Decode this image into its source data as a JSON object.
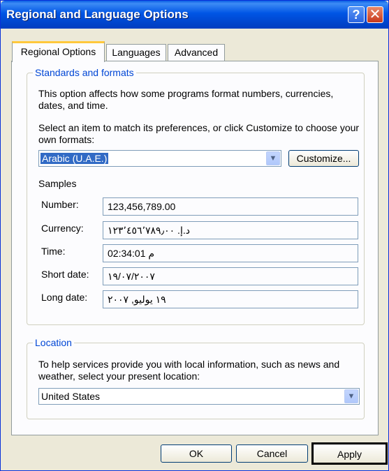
{
  "window": {
    "title": "Regional and Language Options",
    "help_glyph": "?",
    "close_glyph": "✕"
  },
  "tabs": [
    {
      "label": "Regional Options",
      "active": true
    },
    {
      "label": "Languages",
      "active": false
    },
    {
      "label": "Advanced",
      "active": false
    }
  ],
  "standards": {
    "legend": "Standards and formats",
    "desc": "This option affects how some programs format numbers, currencies, dates, and time.",
    "select_prompt": "Select an item to match its preferences, or click Customize to choose your own formats:",
    "selected_format": "Arabic (U.A.E.)",
    "customize_label": "Customize...",
    "samples_label": "Samples",
    "samples": [
      {
        "label": "Number:",
        "value": "123,456,789.00"
      },
      {
        "label": "Currency:",
        "value": "د.إ.‏ ١٢٣٬٤٥٦٬٧٨٩٫٠٠"
      },
      {
        "label": "Time:",
        "value": "02:34:01 م"
      },
      {
        "label": "Short date:",
        "value": "١٩/٠٧/٢٠٠٧"
      },
      {
        "label": "Long date:",
        "value": "١٩ يوليو, ٢٠٠٧"
      }
    ]
  },
  "location": {
    "legend": "Location",
    "desc": "To help services provide you with local information, such as news and weather, select your present location:",
    "selected": "United States"
  },
  "buttons": {
    "ok": "OK",
    "cancel": "Cancel",
    "apply": "Apply"
  },
  "icons": {
    "dropdown": "▼"
  }
}
